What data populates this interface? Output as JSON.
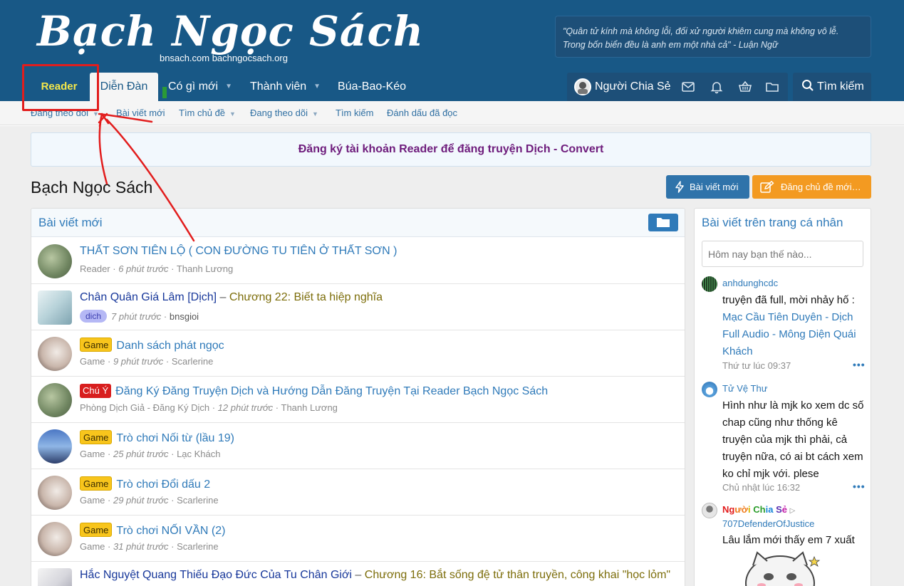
{
  "header": {
    "logo_main": "Bạch Ngọc Sách",
    "logo_sub": "bnsach.com bachngocsach.org",
    "quote_line1": "\"Quân tử kính mà không lỗi, đối xử người khiêm cung mà không vô lễ.",
    "quote_line2": "Trong bốn biển đều là anh em một nhà cả\" - Luận Ngữ"
  },
  "nav": {
    "reader": "Reader",
    "dien_dan": "Diễn Đàn",
    "co_gi_moi": "Có gì mới",
    "thanh_vien": "Thành viên",
    "bua_bao_keo": "Búa-Bao-Kéo",
    "user_name": "Người Chia Sẻ",
    "search": "Tìm kiếm"
  },
  "subnav": {
    "items": [
      "Đang theo dõi",
      "Bài viết mới",
      "Tìm chủ đề",
      "Đang theo dõi",
      "Tìm kiếm",
      "Đánh dấu đã đọc"
    ]
  },
  "notice": "Đăng ký tài khoản Reader để đăng truyện Dịch - Convert",
  "page": {
    "title": "Bạch Ngọc Sách",
    "btn_new_posts": "Bài viết mới",
    "btn_post_thread": "Đăng chủ đề mới…"
  },
  "new_posts": {
    "title": "Bài viết mới",
    "rows": [
      {
        "title": "THẤT SƠN TIÊN LỘ ( CON ĐƯỜNG TU TIÊN Ở THẤT SƠN )",
        "forum": "Reader",
        "time": "6 phút trước",
        "user": "Thanh Lương"
      },
      {
        "title": "Chân Quân Giá Lâm [Dịch]",
        "sep": " – ",
        "chapter": "Chương 22: Biết ta hiệp nghĩa",
        "tag": "dich",
        "time": "7 phút trước",
        "user": "bnsgioi"
      },
      {
        "tag": "Game",
        "title": "Danh sách phát ngọc",
        "forum": "Game",
        "time": "9 phút trước",
        "user": "Scarlerine"
      },
      {
        "tag": "Chú Ý",
        "title": "Đăng Ký Đăng Truyện Dịch và Hướng Dẫn Đăng Truyện Tại Reader Bạch Ngọc Sách",
        "forum": "Phòng Dịch Giả - Đăng Ký Dịch",
        "time": "12 phút trước",
        "user": "Thanh Lương"
      },
      {
        "tag": "Game",
        "title": "Trò chơi Nối từ (lầu 19)",
        "forum": "Game",
        "time": "25 phút trước",
        "user": "Lạc Khách"
      },
      {
        "tag": "Game",
        "title": "Trò chơi Đổi dấu 2",
        "forum": "Game",
        "time": "29 phút trước",
        "user": "Scarlerine"
      },
      {
        "tag": "Game",
        "title": "Trò chơi NỐI VẦN (2)",
        "forum": "Game",
        "time": "31 phút trước",
        "user": "Scarlerine"
      },
      {
        "title": "Hắc Nguyệt Quang Thiếu Đạo Đức Của Tu Chân Giới",
        "sep": " – ",
        "chapter": "Chương 16: Bắt sống đệ tử thân truyền, công khai \"học lỏm\""
      }
    ]
  },
  "profile_posts": {
    "title": "Bài viết trên trang cá nhân",
    "placeholder": "Hôm nay bạn thế nào...",
    "items": [
      {
        "user": "anhdunghcdc",
        "text": "truyện đã full, mời nhảy hố :",
        "link": "Mạc Cầu Tiên Duyên - Dịch Full Audio - Mông Diện Quái Khách",
        "time": "Thứ tư lúc 09:37"
      },
      {
        "user": "Tử Vệ Thư",
        "text": "Hình như là mjk ko xem dc số chap cũng như thống kê truyện của mjk thì phải, cả truyện nữa, có ai bt cách xem ko chỉ mjk với. plese",
        "time": "Chủ nhật lúc 16:32"
      },
      {
        "user": "Người Chia Sẻ",
        "target": "707DefenderOfJustice",
        "text": "Lâu lắm mới thấy em 7 xuất"
      }
    ],
    "more": "•••"
  }
}
